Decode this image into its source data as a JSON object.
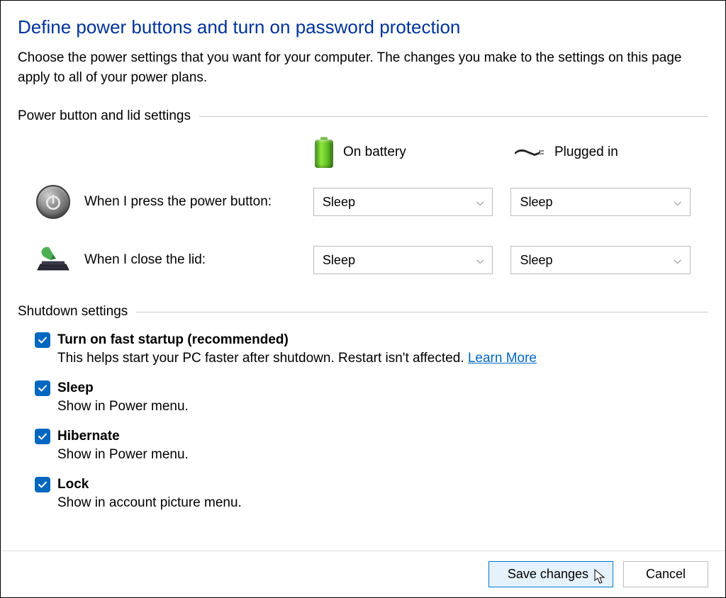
{
  "title": "Define power buttons and turn on password protection",
  "subtitle": "Choose the power settings that you want for your computer. The changes you make to the settings on this page apply to all of your power plans.",
  "section1": {
    "heading": "Power button and lid settings",
    "col_battery": "On battery",
    "col_plugged": "Plugged in",
    "rows": [
      {
        "label": "When I press the power button:",
        "battery_value": "Sleep",
        "plugged_value": "Sleep"
      },
      {
        "label": "When I close the lid:",
        "battery_value": "Sleep",
        "plugged_value": "Sleep"
      }
    ]
  },
  "section2": {
    "heading": "Shutdown settings",
    "items": [
      {
        "checked": true,
        "label": "Turn on fast startup (recommended)",
        "desc": "This helps start your PC faster after shutdown. Restart isn't affected. ",
        "link": "Learn More"
      },
      {
        "checked": true,
        "label": "Sleep",
        "desc": "Show in Power menu."
      },
      {
        "checked": true,
        "label": "Hibernate",
        "desc": "Show in Power menu."
      },
      {
        "checked": true,
        "label": "Lock",
        "desc": "Show in account picture menu."
      }
    ]
  },
  "footer": {
    "save": "Save changes",
    "cancel": "Cancel"
  }
}
